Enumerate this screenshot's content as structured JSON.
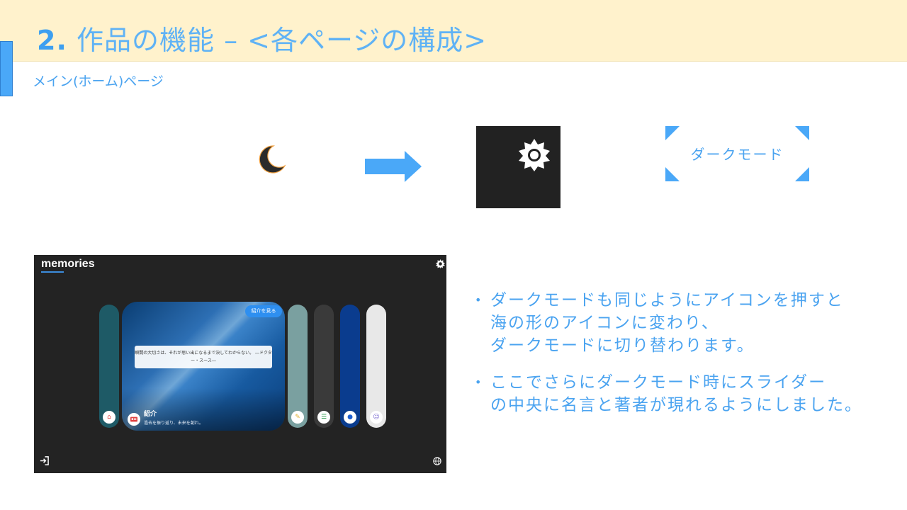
{
  "slide": {
    "title_number": "2.",
    "title_text": "作品の機能 – <各ページの構成>",
    "subtitle": "メイン(ホーム)ページ"
  },
  "illustration": {
    "moon_icon": "moon-icon",
    "arrow_icon": "right-arrow-icon",
    "sun_icon": "sun-gear-icon",
    "callout_label": "ダークモード"
  },
  "app_screenshot": {
    "logo": "memories",
    "header_icon": "gear-icon",
    "intro_button": "紹介を見る",
    "quote": "瞬間の大切さは、それが思い出になるまで決してわからない。 ―ドクター・スース―",
    "intro_title": "紹介",
    "intro_desc": "過去を振り返り、未来を創れ。",
    "panels": [
      {
        "name": "home",
        "icon": "home-icon",
        "color": "#1e5a66"
      },
      {
        "name": "edit",
        "icon": "pencil-icon",
        "color": "#7aa0a0"
      },
      {
        "name": "list",
        "icon": "list-icon",
        "color": "#3a3a3a"
      },
      {
        "name": "chat",
        "icon": "chat-icon",
        "color": "#0a3c8e"
      },
      {
        "name": "user",
        "icon": "user-icon",
        "color": "#e8e8e8"
      }
    ],
    "footer_left_icon": "login-icon",
    "footer_right_icon": "globe-icon"
  },
  "bullets": [
    {
      "lines": [
        "ダークモードも同じようにアイコンを押すと",
        "海の形のアイコンに変わり、",
        "ダークモードに切り替わります。"
      ]
    },
    {
      "lines": [
        "ここでさらにダークモード時にスライダー",
        "の中央に名言と著者が現れるようにしました。"
      ]
    }
  ],
  "colors": {
    "accent": "#4aa3f0",
    "header_band": "#fff2cc",
    "dark_bg": "#222222"
  }
}
